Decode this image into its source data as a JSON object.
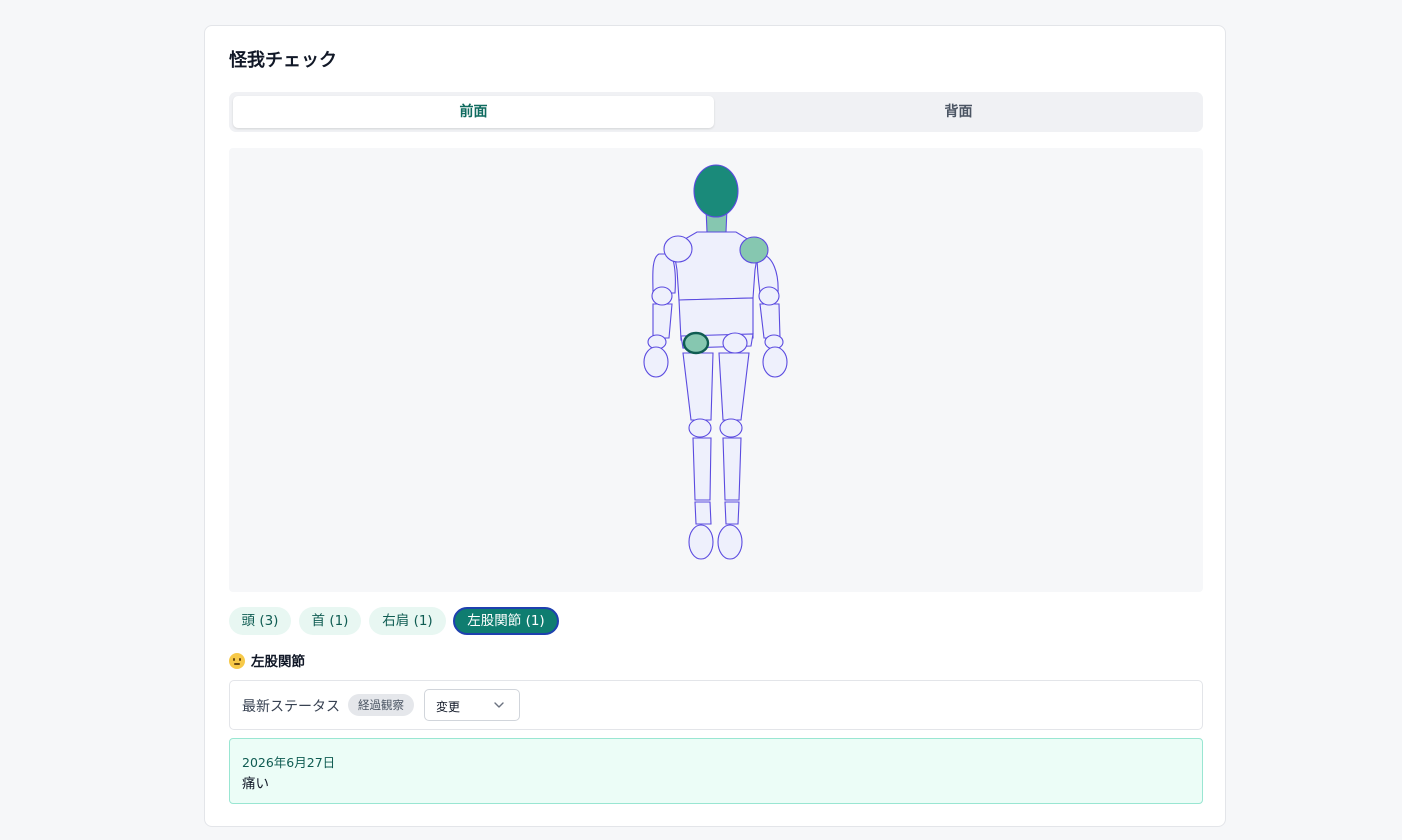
{
  "title": "怪我チェック",
  "tabs": {
    "front": "前面",
    "back": "背面"
  },
  "selected_tab": "前面",
  "body_map": {
    "highlighted_parts": [
      "頭",
      "首",
      "右肩",
      "左股関節"
    ],
    "selected_part": "左股関節"
  },
  "chips": [
    {
      "label": "頭 (3)",
      "active": false
    },
    {
      "label": "首 (1)",
      "active": false
    },
    {
      "label": "右肩 (1)",
      "active": false
    },
    {
      "label": "左股関節 (1)",
      "active": true
    }
  ],
  "detail": {
    "icon": "flushed-face-icon",
    "title": "左股関節"
  },
  "status": {
    "label": "最新ステータス",
    "badge": "経過観察",
    "select_value": "変更"
  },
  "note": {
    "date": "2026年6月27日",
    "text": "痛い"
  },
  "colors": {
    "accent": "#0f7d70",
    "head_fill": "#1a8a7a",
    "injury_fill": "#86c7b0",
    "outline": "#5b4be0",
    "body_fill": "#eef0fc"
  }
}
